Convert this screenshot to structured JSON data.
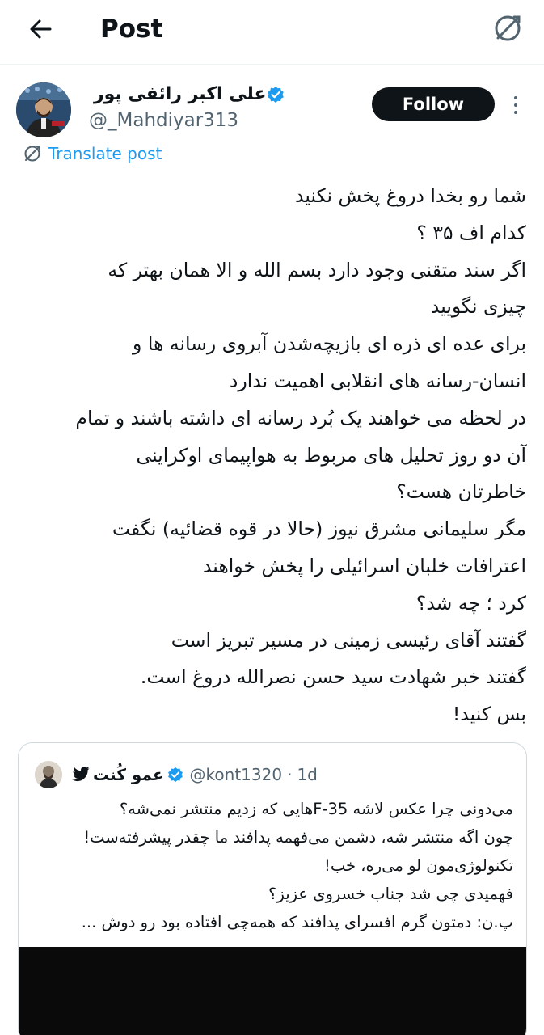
{
  "header": {
    "title": "Post"
  },
  "author": {
    "display_name": "علی اکبر رائفی پور",
    "handle": "@_Mahdiyar313",
    "follow_label": "Follow"
  },
  "translate_label": "Translate post",
  "tweet": {
    "lines": [
      "شما رو بخدا دروغ پخش نکنید",
      "کدام اف ۳۵ ؟",
      "اگر سند متقنی وجود دارد بسم الله و الا همان بهتر که",
      "چیزی نگویید",
      "برای عده ای ذره ای بازیچه‌شدن آبروی رسانه ها و",
      "انسان-رسانه های انقلابی اهمیت ندارد",
      "در لحظه می خواهند یک بُرد رسانه ای داشته باشند و تمام",
      "آن دو روز تحلیل های مربوط به هواپیمای اوکراینی",
      "خاطرتان هست؟",
      "مگر سلیمانی مشرق نیوز (حالا در قوه قضائیه) نگفت",
      "اعترافات خلبان اسرائیلی را پخش خواهند",
      "کرد ؛ چه شد؟",
      "گفتند آقای رئیسی زمینی در مسیر تبریز است",
      "گفتند خبر شهادت سید حسن نصرالله دروغ است.",
      "بس کنید!"
    ]
  },
  "quote": {
    "display_name": "عمو کُنت",
    "handle": "@kont1320",
    "separator": "·",
    "time": "1d",
    "lines": [
      "می‌دونی چرا عکس لاشه F-35هایی که زدیم منتشر نمی‌شه؟",
      "چون اگه منتشر شه، دشمن می‌فهمه پدافند ما چقدر پیشرفته‌ست!",
      "تکنولوژی‌مون لو می‌ره، خب!",
      "فهمیدی چی شد جناب خسروی عزیز؟",
      "پ.ن: دمتون گرم افسرای پدافند که همه‌چی افتاده بود رو دوش ..."
    ]
  },
  "colors": {
    "accent": "#1d9bf0",
    "text": "#0f1419",
    "secondary": "#536471",
    "follow_bg": "#0f1419",
    "border": "#cfd9de"
  },
  "icons": {
    "back": "arrow-left-icon",
    "translate": "translate-icon",
    "verified": "verified-badge-icon",
    "bird": "bird-icon",
    "more": "more-vertical-icon"
  }
}
